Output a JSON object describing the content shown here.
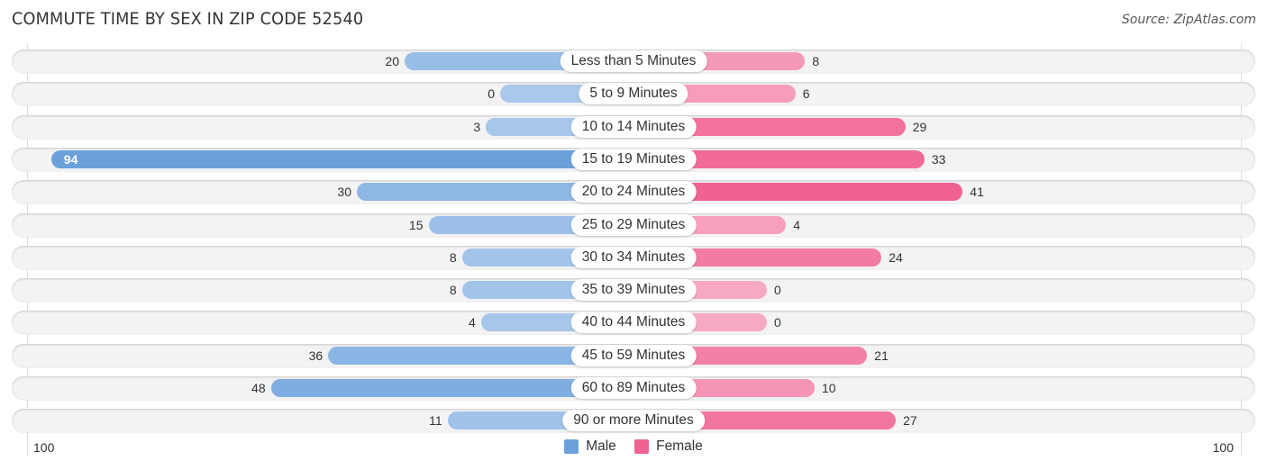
{
  "header": {
    "title": "COMMUTE TIME BY SEX IN ZIP CODE 52540",
    "source": "Source: ZipAtlas.com"
  },
  "colors": {
    "male": "#6aa0dc",
    "male_light": "#a9c8eb",
    "female": "#f06292",
    "female_light": "#f7a8c2"
  },
  "chart_data": {
    "type": "bar",
    "orientation": "horizontal-diverging",
    "title": "COMMUTE TIME BY SEX IN ZIP CODE 52540",
    "categories": [
      "Less than 5 Minutes",
      "5 to 9 Minutes",
      "10 to 14 Minutes",
      "15 to 19 Minutes",
      "20 to 24 Minutes",
      "25 to 29 Minutes",
      "30 to 34 Minutes",
      "35 to 39 Minutes",
      "40 to 44 Minutes",
      "45 to 59 Minutes",
      "60 to 89 Minutes",
      "90 or more Minutes"
    ],
    "series": [
      {
        "name": "Male",
        "values": [
          20,
          0,
          3,
          94,
          30,
          15,
          8,
          8,
          4,
          36,
          48,
          11
        ]
      },
      {
        "name": "Female",
        "values": [
          8,
          6,
          29,
          33,
          41,
          4,
          24,
          0,
          0,
          21,
          10,
          27
        ]
      }
    ],
    "axis": {
      "left_label": "100",
      "right_label": "100",
      "range": [
        0,
        100
      ]
    },
    "legend": {
      "position": "bottom-center",
      "items": [
        "Male",
        "Female"
      ]
    },
    "grid": false
  }
}
